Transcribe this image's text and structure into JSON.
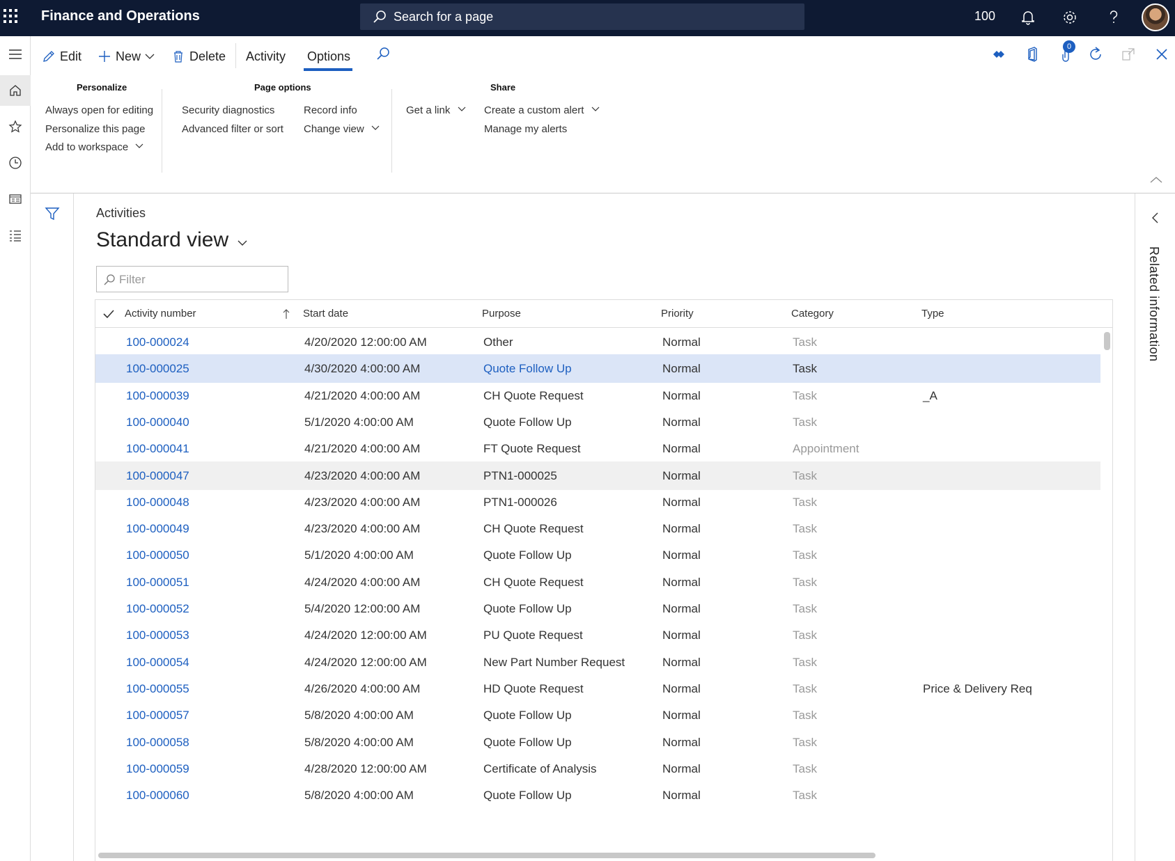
{
  "topbar": {
    "app_title": "Finance and Operations",
    "search_placeholder": "Search for a page",
    "company": "100"
  },
  "actionpane": {
    "commands": {
      "edit": "Edit",
      "new": "New",
      "delete": "Delete",
      "activity": "Activity",
      "options": "Options"
    },
    "groups": {
      "personalize": {
        "title": "Personalize",
        "items": [
          "Always open for editing",
          "Personalize this page",
          "Add to workspace"
        ]
      },
      "page_options": {
        "title": "Page options",
        "items": [
          "Security diagnostics",
          "Advanced filter or sort",
          "Record info",
          "Change view"
        ]
      },
      "share": {
        "title": "Share",
        "items": [
          "Get a link",
          "Create a custom alert",
          "Manage my alerts"
        ]
      }
    },
    "attachments_count": "0"
  },
  "page": {
    "breadcrumb": "Activities",
    "view_title": "Standard view",
    "filter_placeholder": "Filter"
  },
  "grid": {
    "columns": [
      "Activity number",
      "Start date",
      "Purpose",
      "Priority",
      "Category",
      "Type"
    ],
    "rows": [
      {
        "number": "100-000024",
        "start": "4/20/2020 12:00:00 AM",
        "purpose": "Other",
        "priority": "Normal",
        "category": "Task",
        "type": ""
      },
      {
        "number": "100-000025",
        "start": "4/30/2020 4:00:00 AM",
        "purpose": "Quote Follow Up",
        "priority": "Normal",
        "category": "Task",
        "type": ""
      },
      {
        "number": "100-000039",
        "start": "4/21/2020 4:00:00 AM",
        "purpose": "CH Quote Request",
        "priority": "Normal",
        "category": "Task",
        "type": "_A"
      },
      {
        "number": "100-000040",
        "start": "5/1/2020 4:00:00 AM",
        "purpose": "Quote Follow Up",
        "priority": "Normal",
        "category": "Task",
        "type": ""
      },
      {
        "number": "100-000041",
        "start": "4/21/2020 4:00:00 AM",
        "purpose": "FT Quote Request",
        "priority": "Normal",
        "category": "Appointment",
        "type": ""
      },
      {
        "number": "100-000047",
        "start": "4/23/2020 4:00:00 AM",
        "purpose": "PTN1-000025",
        "priority": "Normal",
        "category": "Task",
        "type": ""
      },
      {
        "number": "100-000048",
        "start": "4/23/2020 4:00:00 AM",
        "purpose": "PTN1-000026",
        "priority": "Normal",
        "category": "Task",
        "type": ""
      },
      {
        "number": "100-000049",
        "start": "4/23/2020 4:00:00 AM",
        "purpose": "CH Quote Request",
        "priority": "Normal",
        "category": "Task",
        "type": ""
      },
      {
        "number": "100-000050",
        "start": "5/1/2020 4:00:00 AM",
        "purpose": "Quote Follow Up",
        "priority": "Normal",
        "category": "Task",
        "type": ""
      },
      {
        "number": "100-000051",
        "start": "4/24/2020 4:00:00 AM",
        "purpose": "CH Quote Request",
        "priority": "Normal",
        "category": "Task",
        "type": ""
      },
      {
        "number": "100-000052",
        "start": "5/4/2020 12:00:00 AM",
        "purpose": "Quote Follow Up",
        "priority": "Normal",
        "category": "Task",
        "type": ""
      },
      {
        "number": "100-000053",
        "start": "4/24/2020 12:00:00 AM",
        "purpose": "PU Quote Request",
        "priority": "Normal",
        "category": "Task",
        "type": ""
      },
      {
        "number": "100-000054",
        "start": "4/24/2020 12:00:00 AM",
        "purpose": "New Part Number Request",
        "priority": "Normal",
        "category": "Task",
        "type": ""
      },
      {
        "number": "100-000055",
        "start": "4/26/2020 4:00:00 AM",
        "purpose": "HD Quote Request",
        "priority": "Normal",
        "category": "Task",
        "type": "Price & Delivery Req"
      },
      {
        "number": "100-000057",
        "start": "5/8/2020 4:00:00 AM",
        "purpose": "Quote Follow Up",
        "priority": "Normal",
        "category": "Task",
        "type": ""
      },
      {
        "number": "100-000058",
        "start": "5/8/2020 4:00:00 AM",
        "purpose": "Quote Follow Up",
        "priority": "Normal",
        "category": "Task",
        "type": ""
      },
      {
        "number": "100-000059",
        "start": "4/28/2020 12:00:00 AM",
        "purpose": "Certificate of Analysis",
        "priority": "Normal",
        "category": "Task",
        "type": ""
      },
      {
        "number": "100-000060",
        "start": "5/8/2020 4:00:00 AM",
        "purpose": "Quote Follow Up",
        "priority": "Normal",
        "category": "Task",
        "type": ""
      }
    ],
    "selected_row": 1,
    "hover_row": 5
  },
  "rightpane": {
    "title": "Related information"
  },
  "colors": {
    "topbar_bg": "#0e1a33",
    "link": "#1d5fc0",
    "selected_row": "#dbe5f7"
  }
}
